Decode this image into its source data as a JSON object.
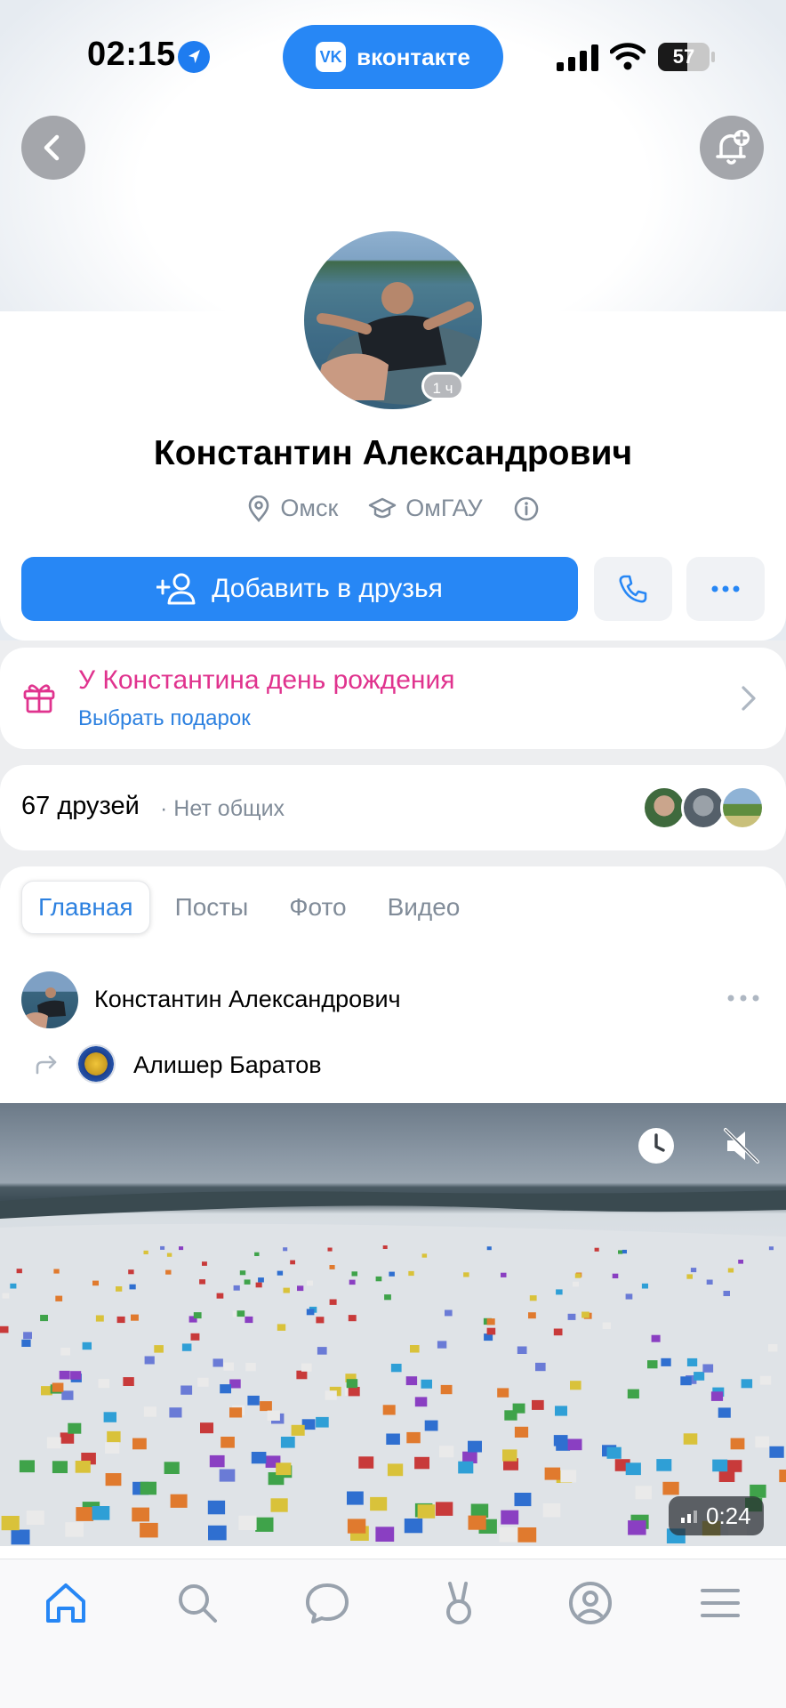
{
  "status_bar": {
    "time": "02:15",
    "battery": "57",
    "battery_level": 0.57
  },
  "app_pill": {
    "logo": "VK",
    "label": "вконтакте"
  },
  "profile": {
    "name": "Константин Александрович",
    "city": "Омск",
    "university": "ОмГАУ",
    "avatar_badge": "1 ч"
  },
  "actions": {
    "add_friend": "Добавить в друзья"
  },
  "birthday": {
    "title": "У Константина день рождения",
    "subtitle": "Выбрать подарок"
  },
  "friends": {
    "count": "67 друзей",
    "common": "· Нет общих"
  },
  "tabs": [
    {
      "label": "Главная",
      "active": true
    },
    {
      "label": "Посты",
      "active": false
    },
    {
      "label": "Фото",
      "active": false
    },
    {
      "label": "Видео",
      "active": false
    }
  ],
  "post": {
    "author": "Константин Александрович",
    "repost_source": "Алишер Баратов",
    "video_duration": "0:24"
  },
  "icons": {
    "back": "chevron-left-icon",
    "notify": "bell-plus-icon",
    "location": "location-pin-icon",
    "education": "graduation-cap-icon",
    "info": "info-icon",
    "add_friend": "user-plus-icon",
    "call": "phone-icon",
    "more": "more-horizontal-icon",
    "gift": "gift-icon",
    "tabbar": [
      "home-icon",
      "search-icon",
      "messages-icon",
      "clips-icon",
      "profile-icon",
      "menu-icon"
    ]
  },
  "colors": {
    "accent": "#2787f5",
    "link": "#2d81e0",
    "birthday": "#e0338e",
    "secondary_text": "#818c99"
  }
}
